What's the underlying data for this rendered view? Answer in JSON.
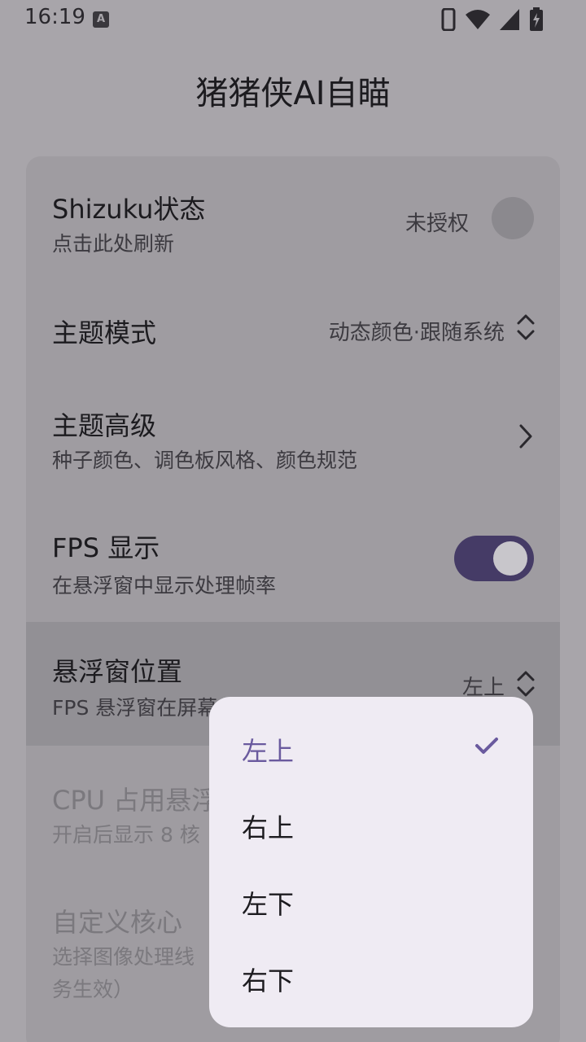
{
  "status_bar": {
    "time": "16:19",
    "notification_letter": "A"
  },
  "app_title": "猪猪侠AI自瞄",
  "settings": {
    "shizuku": {
      "title": "Shizuku状态",
      "subtitle": "点击此处刷新",
      "value": "未授权"
    },
    "theme_mode": {
      "title": "主题模式",
      "value": "动态颜色·跟随系统"
    },
    "theme_advanced": {
      "title": "主题高级",
      "subtitle": "种子颜色、调色板风格、颜色规范"
    },
    "fps_display": {
      "title": "FPS 显示",
      "subtitle": "在悬浮窗中显示处理帧率",
      "enabled": true
    },
    "overlay_position": {
      "title": "悬浮窗位置",
      "subtitle": "FPS 悬浮窗在屏幕上的显示位置",
      "value": "左上"
    },
    "cpu_overlay": {
      "title": "CPU 占用悬浮窗",
      "subtitle": "开启后显示 8 核"
    },
    "custom_core": {
      "title": "自定义核心",
      "subtitle_line1": "选择图像处理线",
      "subtitle_line2": "务生效）"
    }
  },
  "position_menu": {
    "selected": "左上",
    "options": [
      "左上",
      "右上",
      "左下",
      "右下"
    ]
  },
  "colors": {
    "accent": "#6a5a9e",
    "toggle_track": "#453b66",
    "menu_bg": "#efebf3"
  }
}
